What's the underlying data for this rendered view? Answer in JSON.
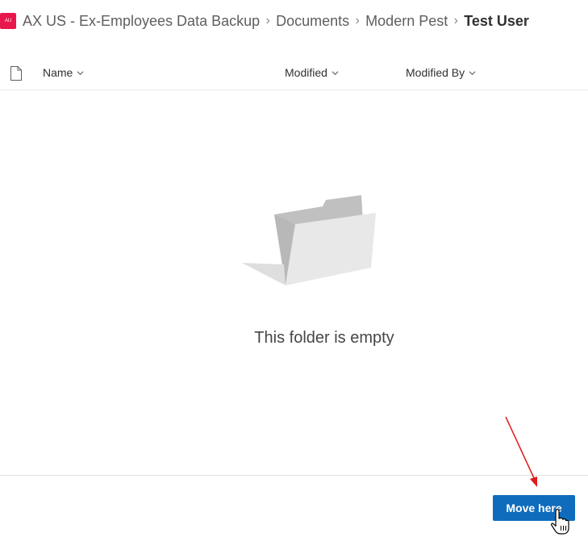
{
  "breadcrumb": {
    "logo_text": "AU",
    "items": [
      "AX US - Ex-Employees Data Backup",
      "Documents",
      "Modern Pest",
      "Test User"
    ]
  },
  "columns": {
    "name": "Name",
    "modified": "Modified",
    "modified_by": "Modified By"
  },
  "empty_state": {
    "message": "This folder is empty"
  },
  "footer": {
    "move_button_label": "Move here"
  },
  "colors": {
    "logo": "#e8174c",
    "primary_button": "#0f6cbd",
    "annotation_arrow": "#e3191c"
  }
}
